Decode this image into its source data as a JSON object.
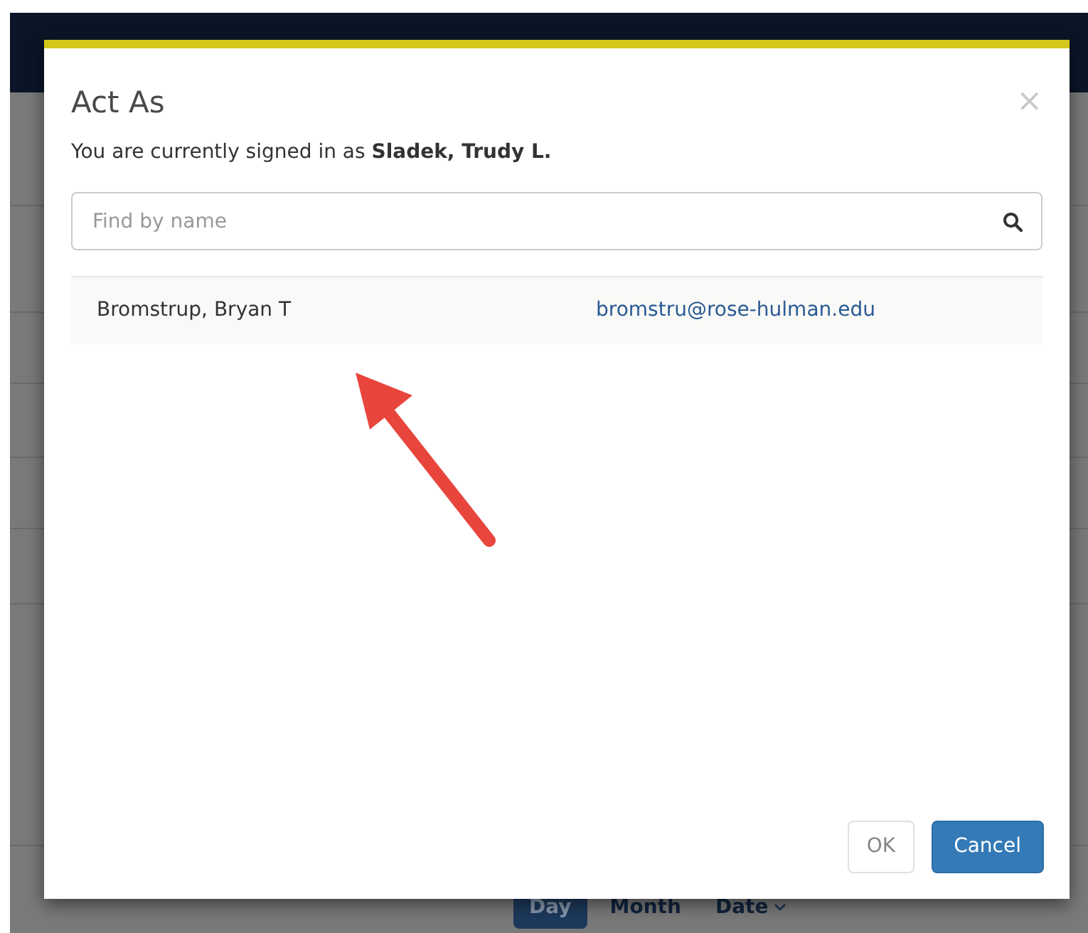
{
  "view_buttons": [
    {
      "label": "Day",
      "selected": true
    },
    {
      "label": "Month",
      "selected": false
    },
    {
      "label": "Date",
      "selected": false,
      "kind": "dropdown"
    }
  ],
  "dialog": {
    "title": "Act As",
    "close": "×",
    "message": "You are currently signed in as **Sladek, Trudy L.**",
    "search": {
      "placeholder": "Find by name"
    },
    "results": [
      {
        "name": "Bromstrup, Bryan T",
        "email": "bromstru@rose-hulman.edu"
      }
    ],
    "buttons": [
      {
        "label": "OK",
        "kind": "default",
        "disabled": true
      },
      {
        "label": "Cancel",
        "kind": "primary",
        "disabled": false
      }
    ]
  }
}
